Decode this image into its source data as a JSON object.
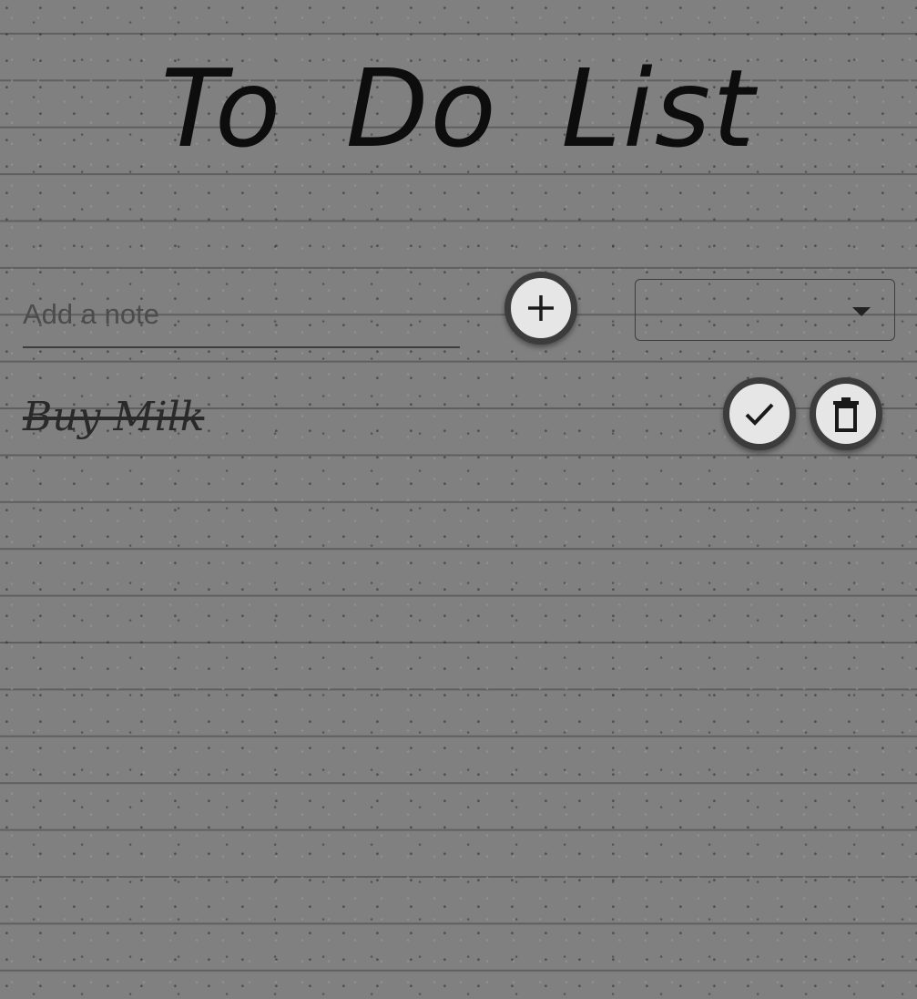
{
  "header": {
    "title": "To Do List"
  },
  "form": {
    "note_placeholder": "Add a note",
    "note_value": "",
    "add_icon": "plus-icon",
    "filter_selected": ""
  },
  "todos": [
    {
      "text": "Buy Milk",
      "completed": true,
      "done_icon": "check-icon",
      "delete_icon": "trash-icon"
    }
  ],
  "colors": {
    "background": "#808080",
    "ruled_line": "#5f5f5f",
    "button_fill": "#e6e6e6",
    "button_border": "#3c3c3c",
    "text": "#0d0d0d"
  }
}
